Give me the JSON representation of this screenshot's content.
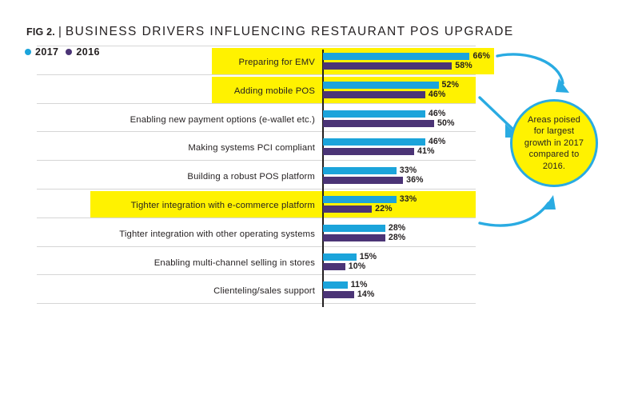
{
  "header": {
    "fig_label": "FIG 2.",
    "separator": "|",
    "title": "BUSINESS DRIVERS INFLUENCING RESTAURANT POS UPGRADE"
  },
  "legend": {
    "items": [
      {
        "label": "2017",
        "color": "#1BA4DB",
        "icon": "legend-dot-icon"
      },
      {
        "label": "2016",
        "color": "#4B3476",
        "icon": "legend-dot-icon"
      }
    ]
  },
  "callout": {
    "text": "Areas poised\nfor largest\ngrowth in 2017\ncompared to\n2016.",
    "fill": "#FFF200",
    "stroke": "#29ABE2"
  },
  "chart_data": {
    "type": "bar",
    "orientation": "horizontal",
    "title": "BUSINESS DRIVERS INFLUENCING RESTAURANT POS UPGRADE",
    "xlabel": "",
    "ylabel": "",
    "xlim": [
      0,
      70
    ],
    "grid": true,
    "legend_position": "top-left",
    "value_suffix": "%",
    "categories": [
      "Preparing for EMV",
      "Adding mobile POS",
      "Enabling new payment options (e-wallet etc.)",
      "Making systems PCI compliant",
      "Building a robust POS platform",
      "Tighter integration with e-commerce platform",
      "Tighter integration with other operating systems",
      "Enabling multi-channel selling in stores",
      "Clienteling/sales support"
    ],
    "highlighted": [
      true,
      true,
      false,
      false,
      false,
      true,
      false,
      false,
      false
    ],
    "series": [
      {
        "name": "2017",
        "color": "#1BA4DB",
        "values": [
          66,
          52,
          46,
          46,
          33,
          33,
          28,
          15,
          11
        ]
      },
      {
        "name": "2016",
        "color": "#4B3476",
        "values": [
          58,
          46,
          50,
          41,
          36,
          22,
          28,
          10,
          14
        ]
      }
    ],
    "labels": {
      "2017": [
        "66%",
        "52%",
        "46%",
        "46%",
        "33%",
        "33%",
        "28%",
        "15%",
        "11%"
      ],
      "2016": [
        "58%",
        "46%",
        "50%",
        "41%",
        "36%",
        "22%",
        "28%",
        "10%",
        "14%"
      ]
    }
  }
}
